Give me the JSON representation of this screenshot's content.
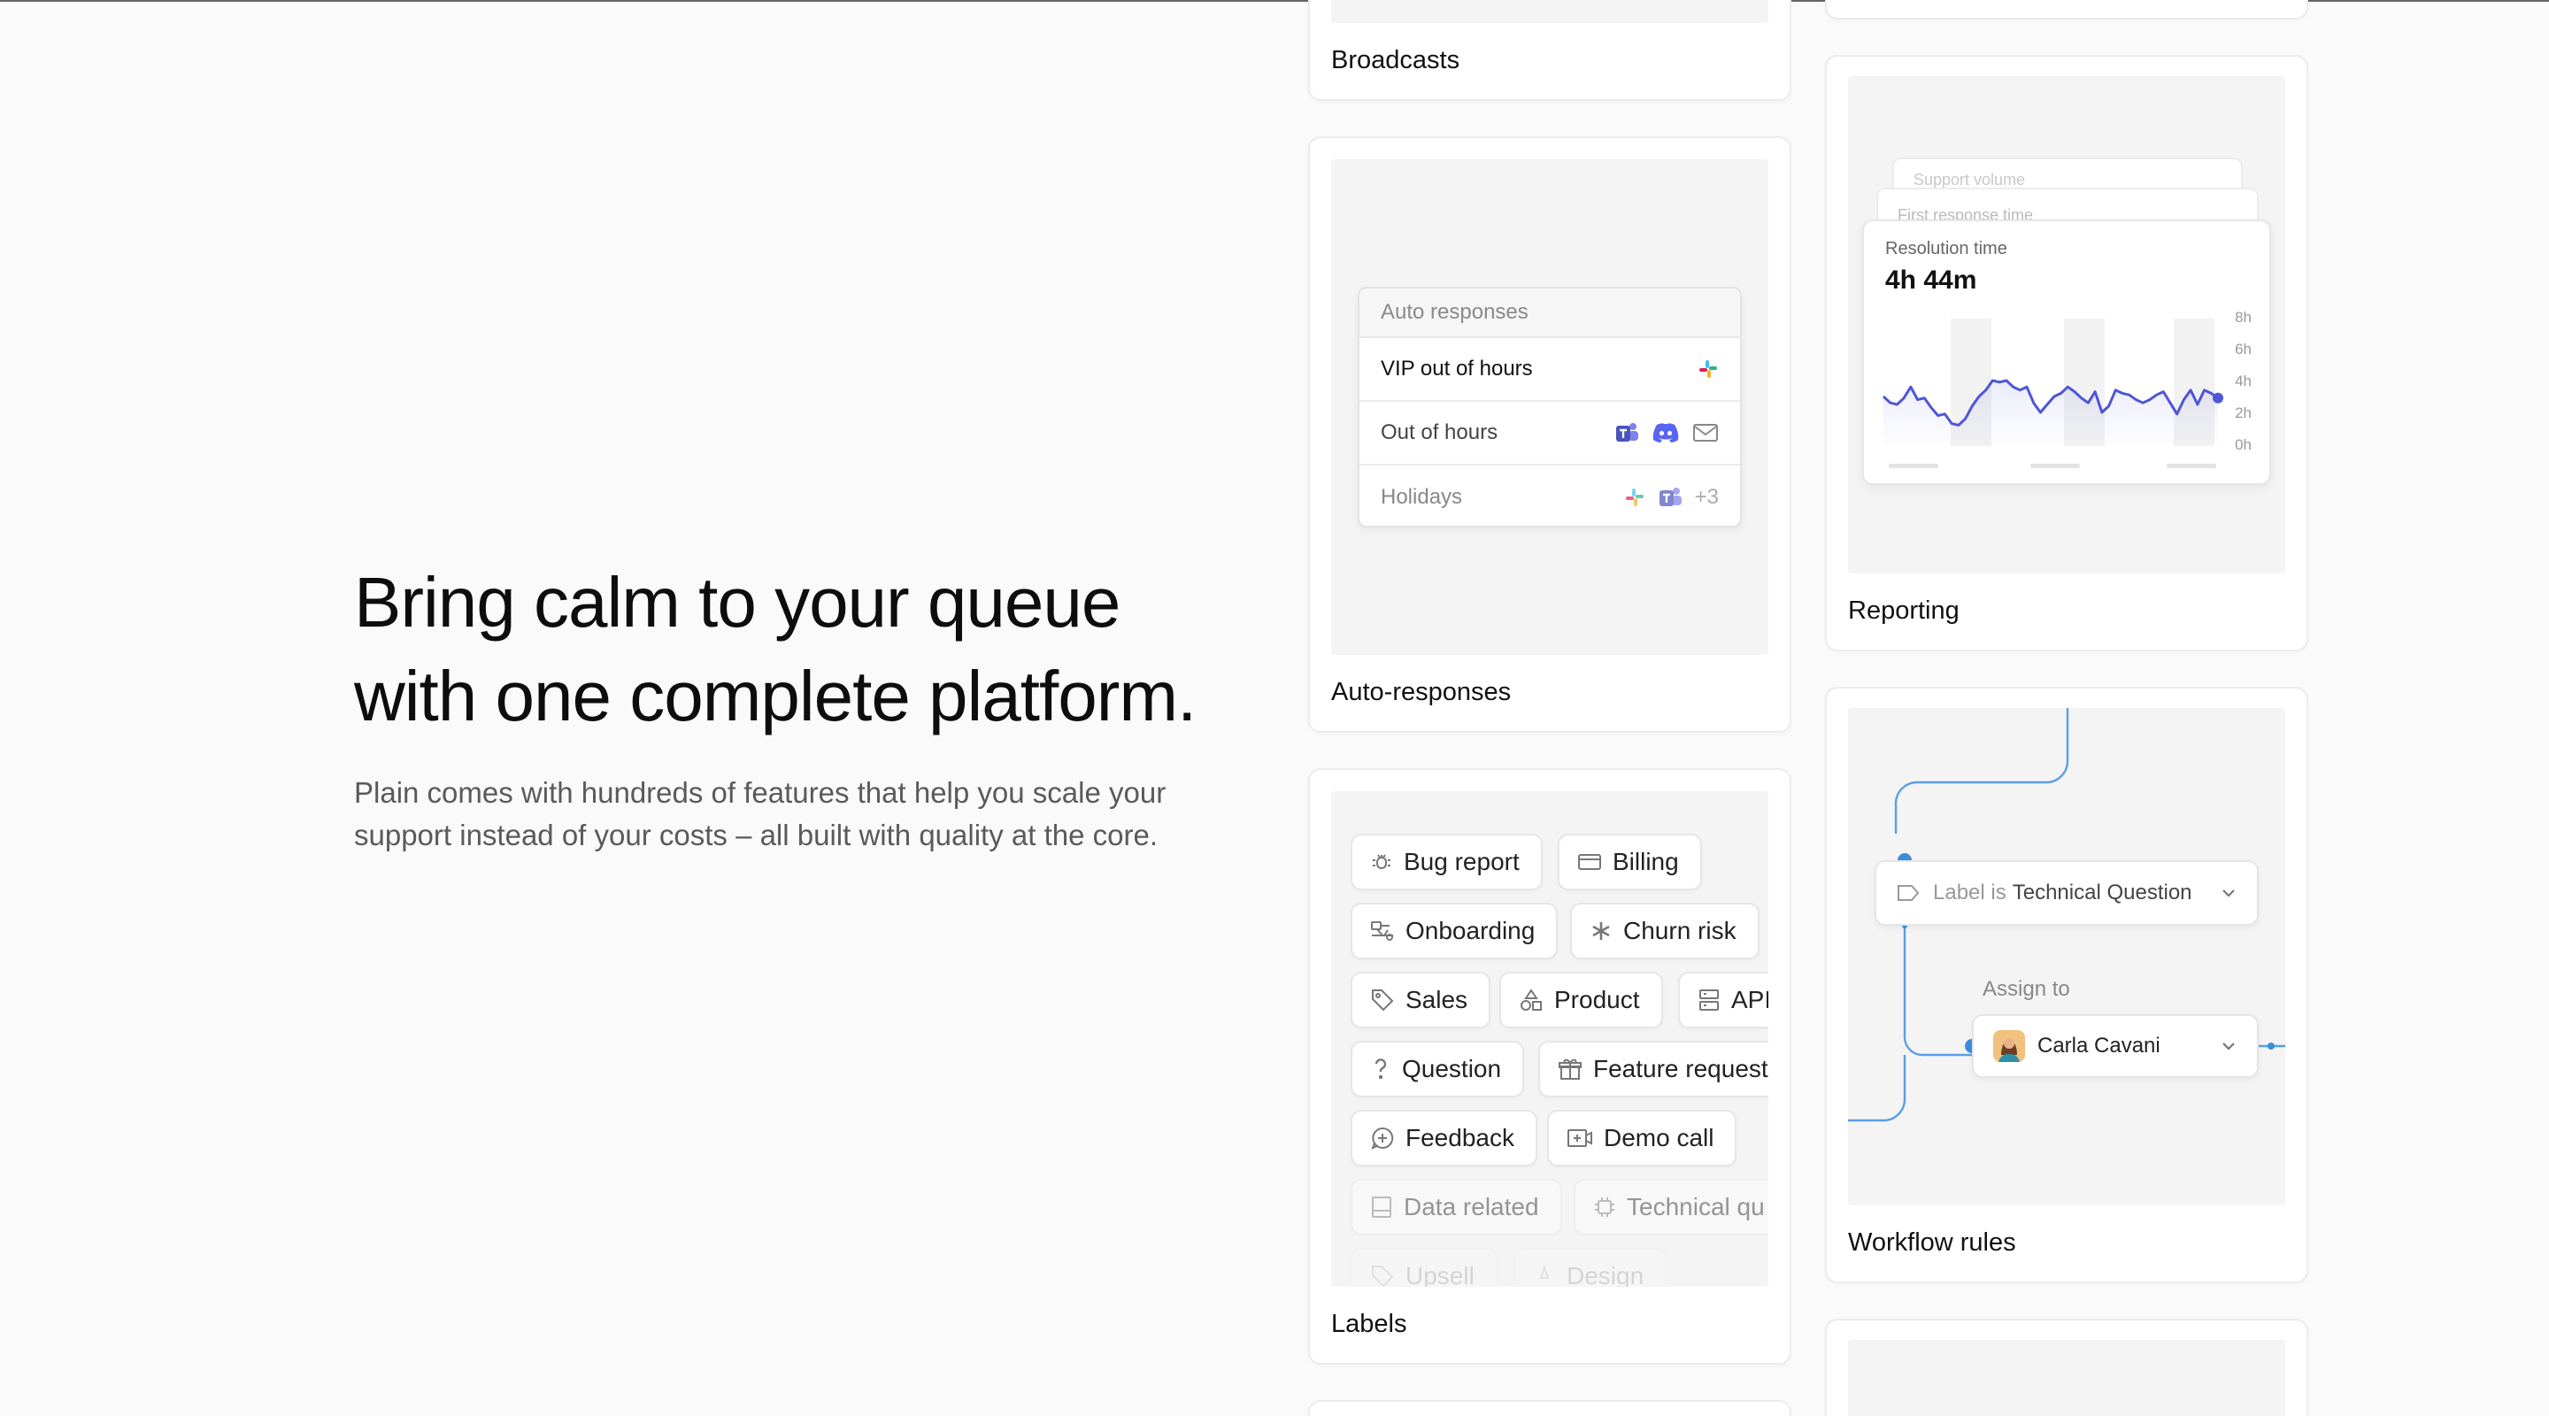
{
  "hero": {
    "title_line1": "Bring calm to your queue",
    "title_line2": "with one complete platform.",
    "subtitle_line1": "Plain comes with hundreds of features that help you scale your",
    "subtitle_line2": "support instead of your costs – all built with quality at the core."
  },
  "cards": {
    "broadcasts": {
      "label": "Broadcasts"
    },
    "auto_responses": {
      "label": "Auto-responses",
      "panel_title": "Auto responses",
      "rows": [
        {
          "name": "VIP out of hours",
          "icons": [
            "slack-icon"
          ]
        },
        {
          "name": "Out of hours",
          "icons": [
            "teams-icon",
            "discord-icon",
            "mail-icon"
          ]
        },
        {
          "name": "Holidays",
          "icons": [
            "slack-icon",
            "teams-icon"
          ],
          "more": "+3"
        }
      ]
    },
    "labels": {
      "label": "Labels",
      "chips": [
        {
          "text": "Bug report",
          "icon": "bug-icon"
        },
        {
          "text": "Billing",
          "icon": "credit-card-icon"
        },
        {
          "text": "Onboarding",
          "icon": "onboarding-icon"
        },
        {
          "text": "Churn risk",
          "icon": "asterisk-icon"
        },
        {
          "text": "Sales",
          "icon": "tag-icon"
        },
        {
          "text": "Product",
          "icon": "shapes-icon"
        },
        {
          "text": "API",
          "icon": "server-icon"
        },
        {
          "text": "Question",
          "icon": "question-icon"
        },
        {
          "text": "Feature request",
          "icon": "gift-icon"
        },
        {
          "text": "Feedback",
          "icon": "chat-plus-icon"
        },
        {
          "text": "Demo call",
          "icon": "video-icon"
        },
        {
          "text": "Data related",
          "icon": "database-icon"
        },
        {
          "text": "Technical qu",
          "icon": "chip-icon"
        },
        {
          "text": "Upsell",
          "icon": "tag-icon"
        },
        {
          "text": "Design",
          "icon": "pen-icon"
        }
      ]
    },
    "reporting": {
      "label": "Reporting",
      "ghost1": "Support volume",
      "ghost2": "First response time",
      "caption": "Resolution time",
      "value": "4h 44m",
      "accent": "#4f55d8"
    },
    "workflow": {
      "label": "Workflow rules",
      "condition_prefix": "Label is",
      "condition_value": "Technical Question",
      "assign_label": "Assign to",
      "assignee": "Carla Cavani",
      "accent": "#3b8ede"
    }
  },
  "chart_data": {
    "type": "line",
    "title": "Resolution time",
    "yticks": [
      "8h",
      "6h",
      "4h",
      "2h",
      "0h"
    ],
    "ylim": [
      0,
      8
    ],
    "values": [
      3.0,
      2.6,
      2.5,
      2.9,
      3.6,
      2.8,
      2.9,
      2.3,
      1.8,
      1.9,
      1.3,
      1.2,
      1.6,
      2.4,
      3.0,
      3.4,
      4.0,
      3.9,
      4.0,
      3.6,
      3.4,
      3.6,
      2.6,
      2.0,
      2.5,
      3.0,
      3.2,
      3.6,
      3.3,
      2.9,
      2.6,
      3.3,
      2.0,
      2.4,
      3.4,
      3.2,
      3.1,
      2.8,
      2.6,
      2.8,
      3.1,
      3.3,
      2.6,
      1.9,
      2.8,
      3.4,
      2.5,
      3.4,
      3.2,
      2.9
    ]
  }
}
